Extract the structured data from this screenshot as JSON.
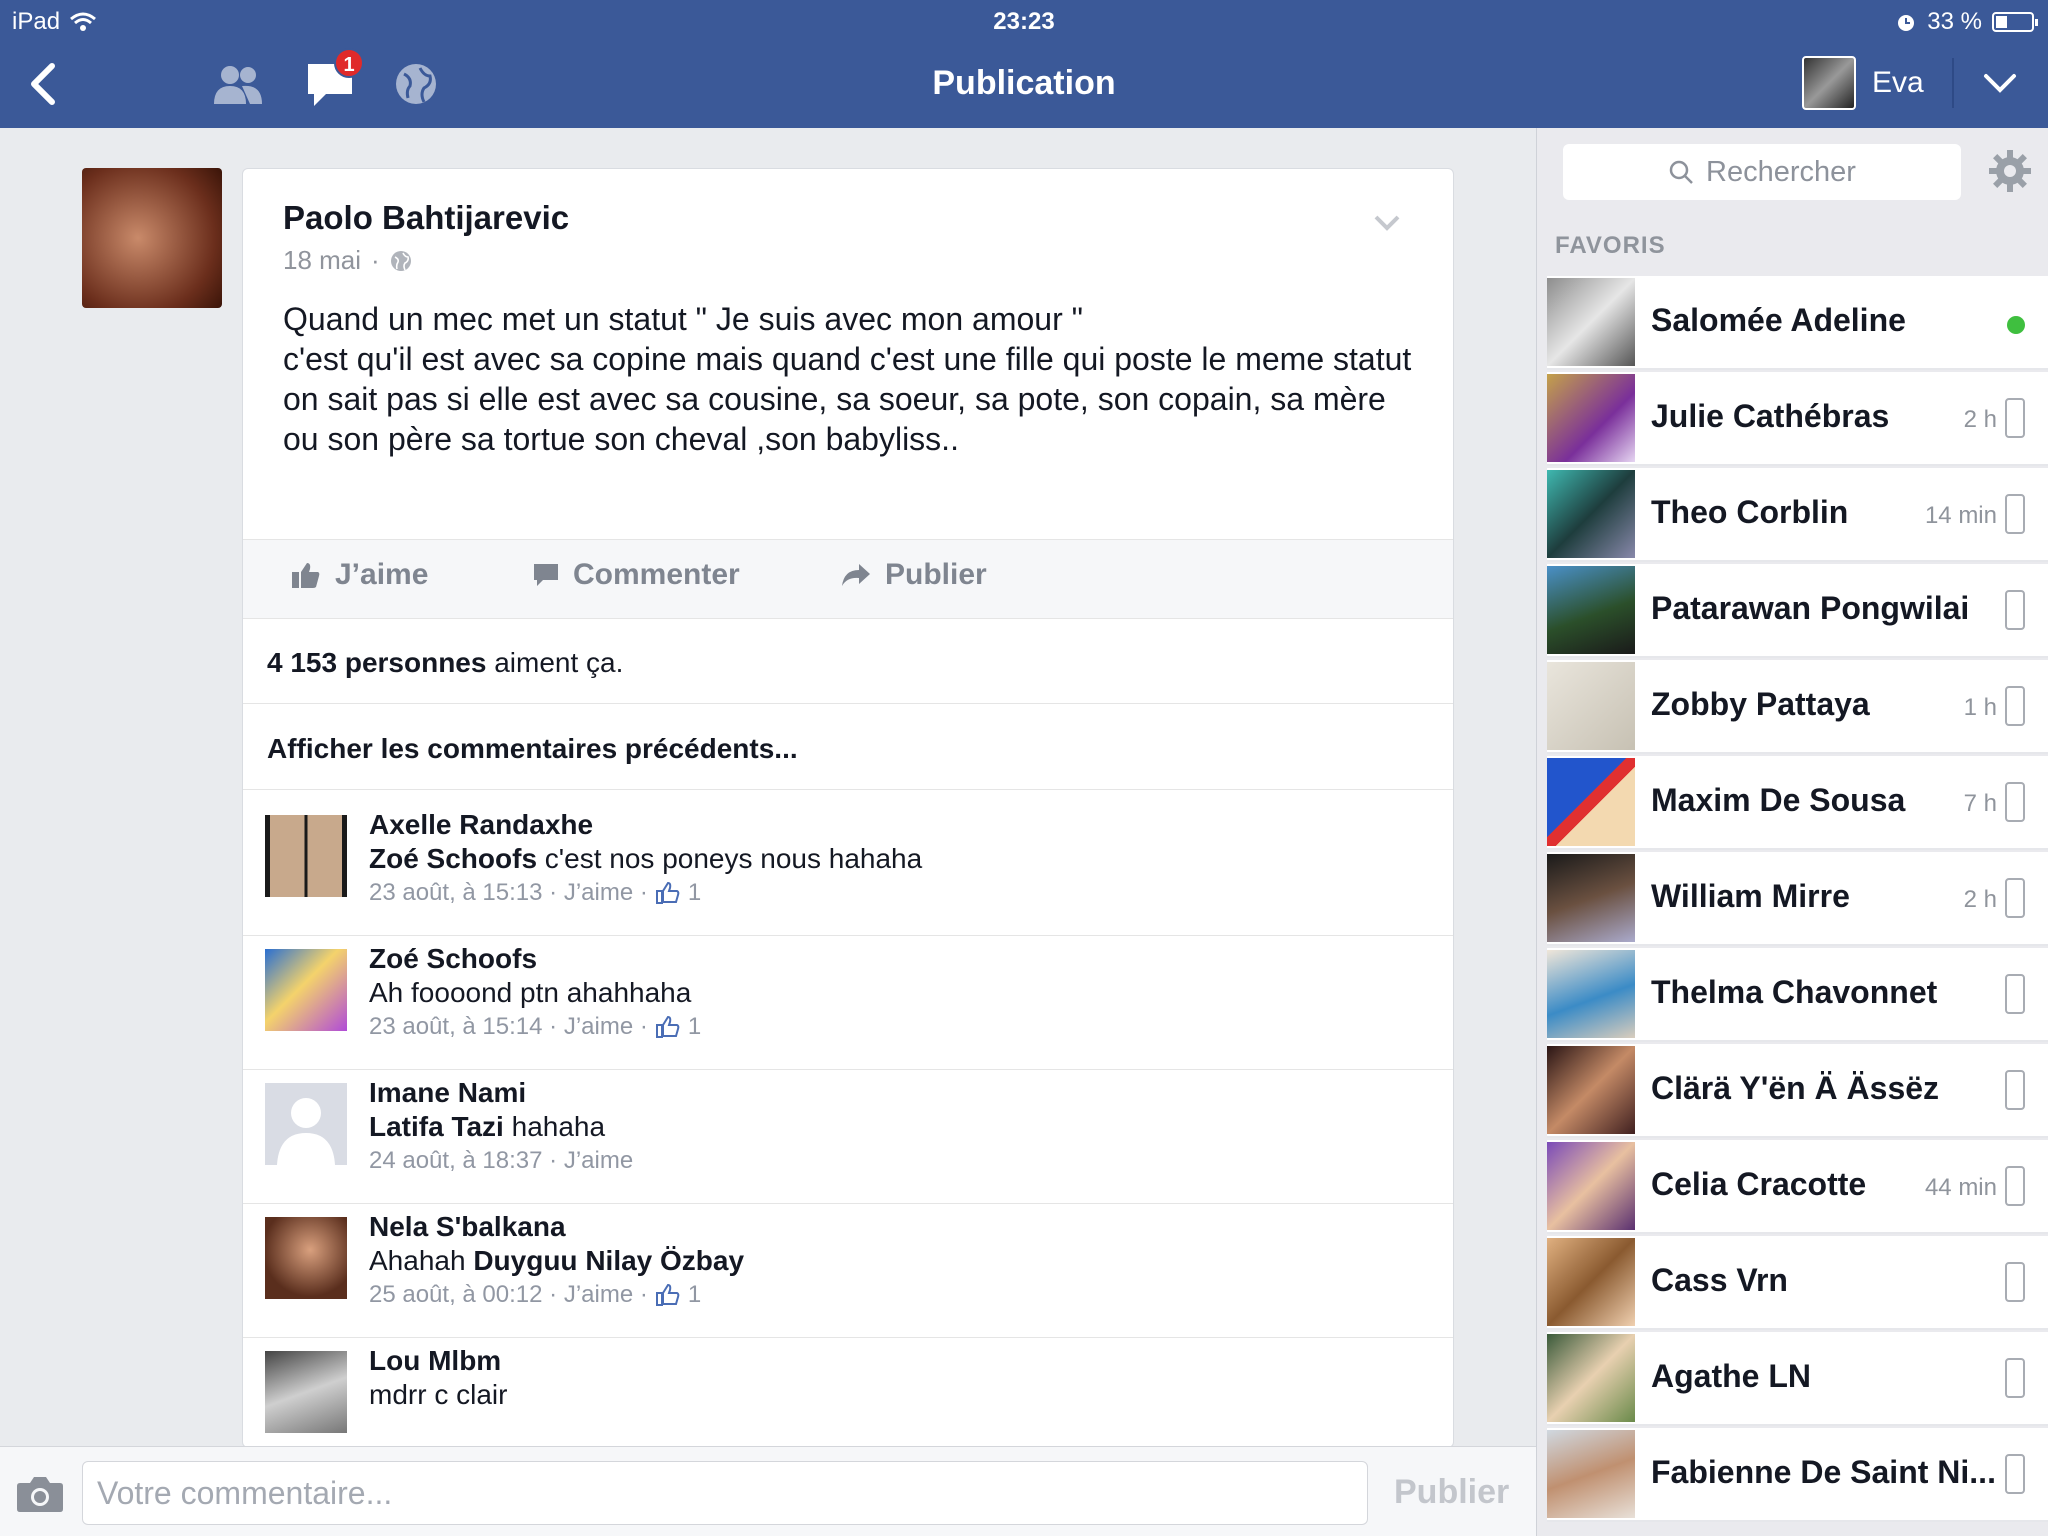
{
  "status_bar": {
    "device": "iPad",
    "time": "23:23",
    "battery": "33 %",
    "battery_level": 0.33
  },
  "nav": {
    "title": "Publication",
    "user_name": "Eva",
    "messages_badge": "1"
  },
  "post": {
    "author": "Paolo Bahtijarevic",
    "date": "18 mai",
    "meta_sep": "·",
    "text": "Quand un mec met un statut \" Je suis avec mon amour \"\nc'est qu'il est avec sa copine mais quand c'est une fille qui poste le meme statut\non sait pas si elle est avec sa cousine, sa soeur, sa pote, son copain, sa mère ou son père sa tortue son cheval ,son babyliss..",
    "actions": {
      "like": "J’aime",
      "comment": "Commenter",
      "share": "Publier"
    },
    "likes_count": "4 153 personnes",
    "likes_suffix": "aiment ça.",
    "previous_comments": "Afficher les commentaires précédents..."
  },
  "comments": [
    {
      "author": "Axelle Randaxhe",
      "mention": "Zoé Schoofs",
      "text": " c'est nos poneys nous hahaha",
      "time": "23 août, à 15:13 · J’aime ·",
      "likes": "1"
    },
    {
      "author": "Zoé Schoofs",
      "mention": "",
      "text": "Ah foooond ptn ahahhaha",
      "time": "23 août, à 15:14 · J’aime ·",
      "likes": "1"
    },
    {
      "author": "Imane Nami",
      "mention": "Latifa Tazi",
      "text": " hahaha",
      "time": "24 août, à 18:37 · J’aime",
      "likes": ""
    },
    {
      "author": "Nela S'balkana",
      "mention": "",
      "text": "Ahahah ",
      "mention_after": "Duyguu Nilay Özbay",
      "time": "25 août, à 00:12 · J’aime ·",
      "likes": "1"
    },
    {
      "author": "Lou Mlbm",
      "mention": "",
      "text": "mdrr c clair",
      "time": "",
      "likes": ""
    }
  ],
  "composer": {
    "placeholder": "Votre commentaire...",
    "publish": "Publier"
  },
  "sidebar": {
    "search_placeholder": "Rechercher",
    "favorites_header": "FAVORIS",
    "contacts": [
      {
        "name": "Salomée Adeline",
        "time": "",
        "status": "online"
      },
      {
        "name": "Julie Cathébras",
        "time": "2 h",
        "status": "mobile"
      },
      {
        "name": "Theo Corblin",
        "time": "14 min",
        "status": "mobile"
      },
      {
        "name": "Patarawan Pongwilai",
        "time": "",
        "status": "mobile"
      },
      {
        "name": "Zobby Pattaya",
        "time": "1 h",
        "status": "mobile"
      },
      {
        "name": "Maxim De Sousa",
        "time": "7 h",
        "status": "mobile"
      },
      {
        "name": "William Mirre",
        "time": "2 h",
        "status": "mobile"
      },
      {
        "name": "Thelma Chavonnet",
        "time": "",
        "status": "mobile"
      },
      {
        "name": "Clärä Y'ën Ä Ässëz",
        "time": "",
        "status": "mobile"
      },
      {
        "name": "Celia Cracotte",
        "time": "44 min",
        "status": "mobile"
      },
      {
        "name": "Cass Vrn",
        "time": "",
        "status": "mobile"
      },
      {
        "name": "Agathe LN",
        "time": "",
        "status": "mobile"
      },
      {
        "name": "Fabienne De Saint Ni...",
        "time": "",
        "status": "mobile"
      }
    ]
  },
  "colors": {
    "brand": "#3b5998",
    "online": "#3fbf3f",
    "badge": "#e02a2a"
  }
}
